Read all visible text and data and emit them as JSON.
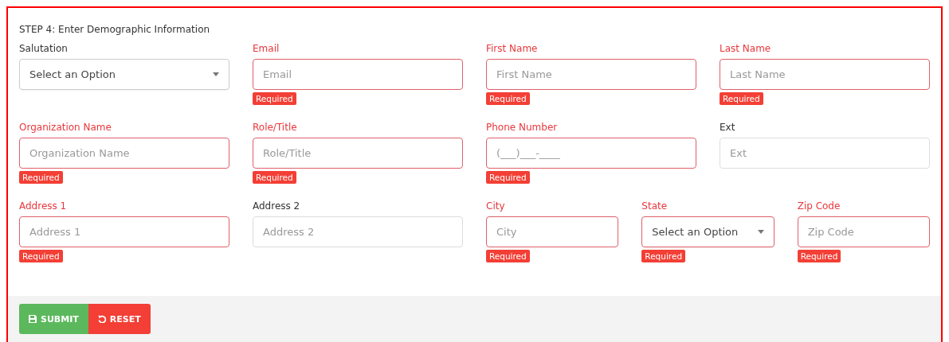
{
  "heading": "STEP 4: Enter Demographic Information",
  "rows": [
    {
      "fields": [
        {
          "label": "Salutation",
          "kind": "select",
          "value": "Select an Option",
          "invalid": false
        },
        {
          "label": "Email",
          "kind": "text",
          "placeholder": "Email",
          "invalid": true,
          "error": "Required"
        },
        {
          "label": "First Name",
          "kind": "text",
          "placeholder": "First Name",
          "invalid": true,
          "error": "Required"
        },
        {
          "label": "Last Name",
          "kind": "text",
          "placeholder": "Last Name",
          "invalid": true,
          "error": "Required"
        }
      ]
    },
    {
      "fields": [
        {
          "label": "Organization Name",
          "kind": "text",
          "placeholder": "Organization Name",
          "invalid": true,
          "error": "Required"
        },
        {
          "label": "Role/Title",
          "kind": "text",
          "placeholder": "Role/Title",
          "invalid": true,
          "error": "Required"
        },
        {
          "label": "Phone Number",
          "kind": "text",
          "placeholder": "(___)___-____",
          "invalid": true,
          "error": "Required"
        },
        {
          "label": "Ext",
          "kind": "text",
          "placeholder": "Ext",
          "invalid": false
        }
      ]
    },
    {
      "fields": [
        {
          "label": "Address 1",
          "kind": "text",
          "placeholder": "Address 1",
          "invalid": true,
          "error": "Required"
        },
        {
          "label": "Address 2",
          "kind": "text",
          "placeholder": "Address 2",
          "invalid": false
        },
        {
          "label": "City",
          "kind": "text",
          "placeholder": "City",
          "invalid": true,
          "error": "Required"
        },
        {
          "label": "State",
          "kind": "select",
          "value": "Select an Option",
          "invalid": true,
          "error": "Required"
        },
        {
          "label": "Zip Code",
          "kind": "text",
          "placeholder": "Zip Code",
          "invalid": true,
          "error": "Required"
        }
      ]
    }
  ],
  "buttons": [
    {
      "label": "SUBMIT",
      "kind": "submit"
    },
    {
      "label": "RESET",
      "kind": "reset"
    }
  ]
}
